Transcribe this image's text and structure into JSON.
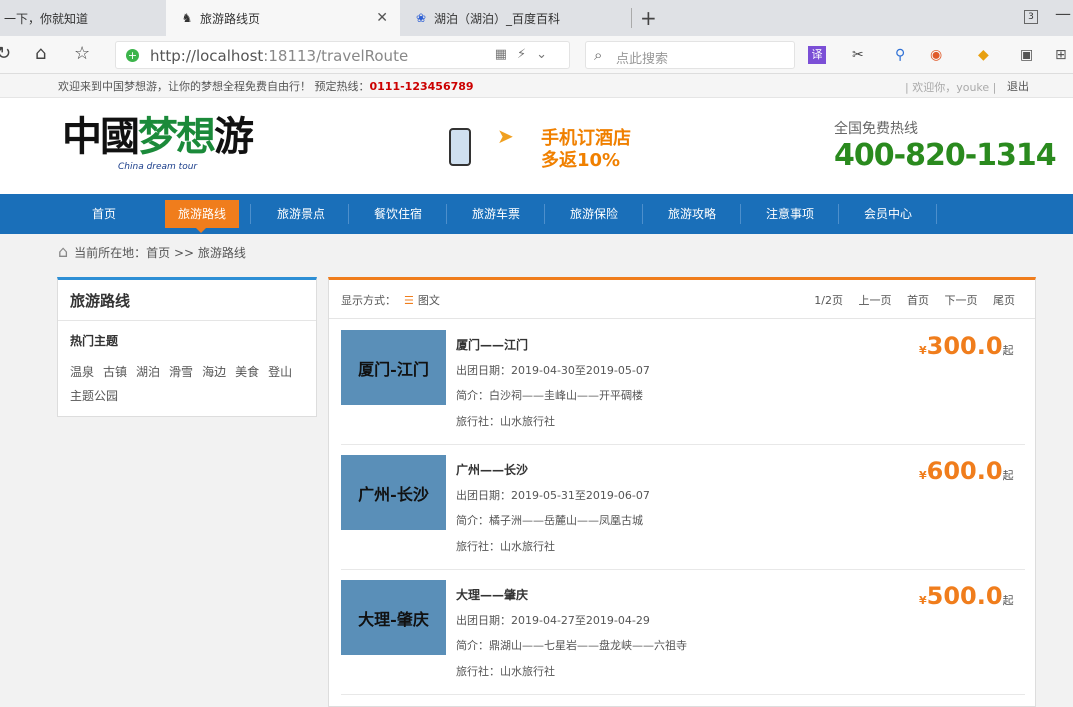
{
  "browser": {
    "tabs": [
      {
        "title": "一下，你就知道",
        "icon": "paw-icon"
      },
      {
        "title": "旅游路线页",
        "icon": "horse-icon"
      },
      {
        "title": "湖泊（湖泊）_百度百科",
        "icon": "paw-icon"
      }
    ],
    "tab_count": "3",
    "url_host": "http://localhost",
    "url_rest": ":18113/travelRoute",
    "search_placeholder": "点此搜索",
    "ext_translate": "译"
  },
  "topbar": {
    "welcome": "欢迎来到中国梦想游，让你的梦想全程免费自由行！ 预定热线：",
    "hotline": "0111-123456789",
    "user": "| 欢迎你，youke |",
    "logout": "退出"
  },
  "header": {
    "logo_text_1": "中國",
    "logo_text_2": "梦想",
    "logo_text_3": "游",
    "logo_sub": "China dream tour",
    "promo_line1": "手机订酒店",
    "promo_line2": "多返10%",
    "hotline_label": "全国免费热线",
    "hotline_number": "400-820-1314"
  },
  "nav": {
    "items": [
      "首页",
      "旅游路线",
      "旅游景点",
      "餐饮住宿",
      "旅游车票",
      "旅游保险",
      "旅游攻略",
      "注意事项",
      "会员中心"
    ],
    "active_index": 1
  },
  "breadcrumb": {
    "text": "当前所在地：首页 >> 旅游路线"
  },
  "sidebar": {
    "title": "旅游路线",
    "hot_title": "热门主题",
    "tags": [
      "温泉",
      "古镇",
      "湖泊",
      "滑雪",
      "海边",
      "美食",
      "登山",
      "主题公园"
    ]
  },
  "content": {
    "view_label": "显示方式：",
    "view_mode": "图文",
    "pager": {
      "page_info": "1/2页",
      "prev": "上一页",
      "first": "首页",
      "next": "下一页",
      "last": "尾页"
    },
    "routes": [
      {
        "thumb": "厦门-江门",
        "title": "厦门——江门",
        "date": "出团日期：2019-04-30至2019-05-07",
        "intro": "简介：白沙祠——圭峰山——开平碉楼",
        "agency": "旅行社：山水旅行社",
        "currency": "¥",
        "price": "300.0",
        "suffix": "起"
      },
      {
        "thumb": "广州-长沙",
        "title": "广州——长沙",
        "date": "出团日期：2019-05-31至2019-06-07",
        "intro": "简介：橘子洲——岳麓山——凤凰古城",
        "agency": "旅行社：山水旅行社",
        "currency": "¥",
        "price": "600.0",
        "suffix": "起"
      },
      {
        "thumb": "大理-肇庆",
        "title": "大理——肇庆",
        "date": "出团日期：2019-04-27至2019-04-29",
        "intro": "简介：鼎湖山——七星岩——盘龙峡——六祖寺",
        "agency": "旅行社：山水旅行社",
        "currency": "¥",
        "price": "500.0",
        "suffix": "起"
      }
    ]
  },
  "colors": {
    "nav_blue": "#1a6fb9",
    "accent_orange": "#f07d1c",
    "hotline_green": "#2a8a1e"
  }
}
